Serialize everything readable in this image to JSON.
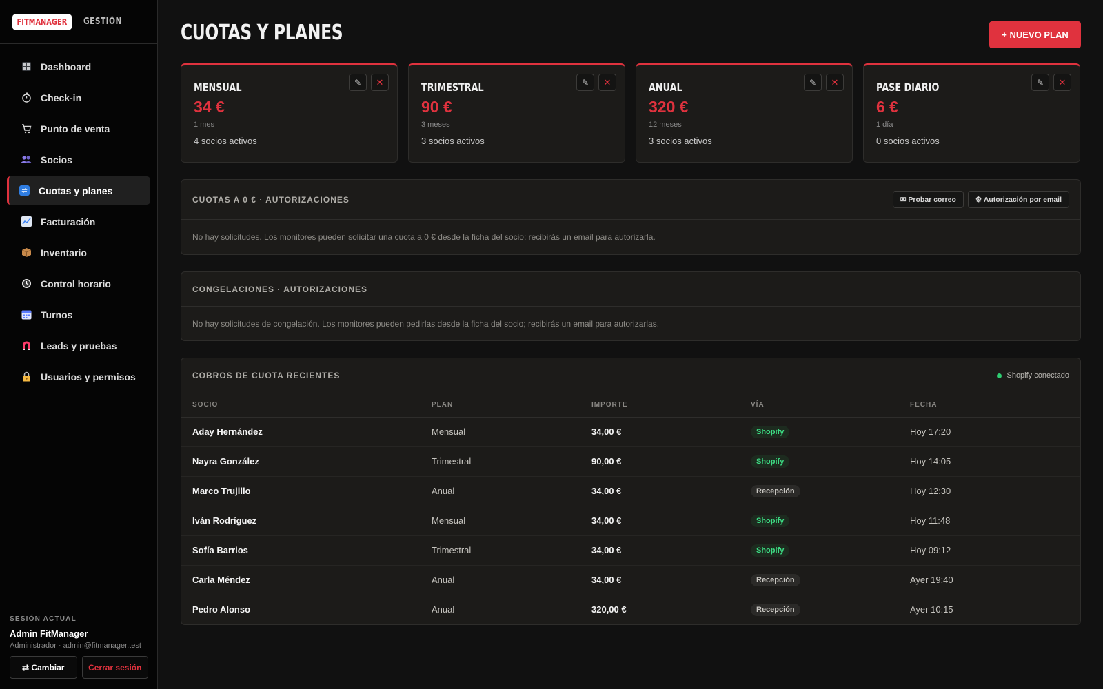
{
  "brand": {
    "badge": "FITMANAGER",
    "sub": "GESTIÓN"
  },
  "sidebar": {
    "items": [
      {
        "label": "Dashboard",
        "icon": "dashboard-icon",
        "color": "#9aa0a6"
      },
      {
        "label": "Check-in",
        "icon": "stopwatch-icon",
        "color": "#cfcfcf"
      },
      {
        "label": "Punto de venta",
        "icon": "cart-icon",
        "color": "#cfcfcf"
      },
      {
        "label": "Socios",
        "icon": "users-icon",
        "color": "#7b68ee"
      },
      {
        "label": "Cuotas y planes",
        "icon": "repeat-icon",
        "color": "#3b82f6"
      },
      {
        "label": "Facturación",
        "icon": "chart-icon",
        "color": "#60a5fa"
      },
      {
        "label": "Inventario",
        "icon": "box-icon",
        "color": "#c8894a"
      },
      {
        "label": "Control horario",
        "icon": "clock-icon",
        "color": "#d0d0d0"
      },
      {
        "label": "Turnos",
        "icon": "calendar-icon",
        "color": "#6b8cff"
      },
      {
        "label": "Leads y pruebas",
        "icon": "magnet-icon",
        "color": "#ff3b6b"
      },
      {
        "label": "Usuarios y permisos",
        "icon": "lock-icon",
        "color": "#f5b942"
      }
    ],
    "active_index": 4
  },
  "session": {
    "title": "SESIÓN ACTUAL",
    "name": "Admin FitManager",
    "sub": "Administrador · admin@fitmanager.test",
    "change_label": "⇄ Cambiar",
    "logout_label": "Cerrar sesión"
  },
  "header": {
    "title": "CUOTAS Y PLANES",
    "new_plan_label": "+ NUEVO PLAN"
  },
  "plans": [
    {
      "name": "MENSUAL",
      "price": "34 €",
      "duration": "1 mes",
      "active": "4 socios activos"
    },
    {
      "name": "TRIMESTRAL",
      "price": "90 €",
      "duration": "3 meses",
      "active": "3 socios activos"
    },
    {
      "name": "ANUAL",
      "price": "320 €",
      "duration": "12 meses",
      "active": "3 socios activos"
    },
    {
      "name": "PASE DIARIO",
      "price": "6 €",
      "duration": "1 día",
      "active": "0 socios activos"
    }
  ],
  "zero_quotas": {
    "title": "CUOTAS A 0 € · AUTORIZACIONES",
    "test_email_label": "✉ Probar correo",
    "auth_email_label": "⚙ Autorización por email",
    "message": "No hay solicitudes. Los monitores pueden solicitar una cuota a 0 € desde la ficha del socio; recibirás un email para autorizarla."
  },
  "freezes": {
    "title": "CONGELACIONES · AUTORIZACIONES",
    "message": "No hay solicitudes de congelación. Los monitores pueden pedirlas desde la ficha del socio; recibirás un email para autorizarlas."
  },
  "payments": {
    "title": "COBROS DE CUOTA RECIENTES",
    "status": "Shopify conectado",
    "columns": [
      "SOCIO",
      "PLAN",
      "IMPORTE",
      "VÍA",
      "FECHA"
    ],
    "rows": [
      {
        "socio": "Aday Hernández",
        "plan": "Mensual",
        "importe": "34,00 €",
        "via": "Shopify",
        "fecha": "Hoy 17:20"
      },
      {
        "socio": "Nayra González",
        "plan": "Trimestral",
        "importe": "90,00 €",
        "via": "Shopify",
        "fecha": "Hoy 14:05"
      },
      {
        "socio": "Marco Trujillo",
        "plan": "Anual",
        "importe": "34,00 €",
        "via": "Recepción",
        "fecha": "Hoy 12:30"
      },
      {
        "socio": "Iván Rodríguez",
        "plan": "Mensual",
        "importe": "34,00 €",
        "via": "Shopify",
        "fecha": "Hoy 11:48"
      },
      {
        "socio": "Sofía Barrios",
        "plan": "Trimestral",
        "importe": "34,00 €",
        "via": "Shopify",
        "fecha": "Hoy 09:12"
      },
      {
        "socio": "Carla Méndez",
        "plan": "Anual",
        "importe": "34,00 €",
        "via": "Recepción",
        "fecha": "Ayer 19:40"
      },
      {
        "socio": "Pedro Alonso",
        "plan": "Anual",
        "importe": "320,00 €",
        "via": "Recepción",
        "fecha": "Ayer 10:15"
      }
    ]
  },
  "colors": {
    "accent": "#e0323e",
    "shopify": "#3ddc84",
    "background": "#111111"
  }
}
